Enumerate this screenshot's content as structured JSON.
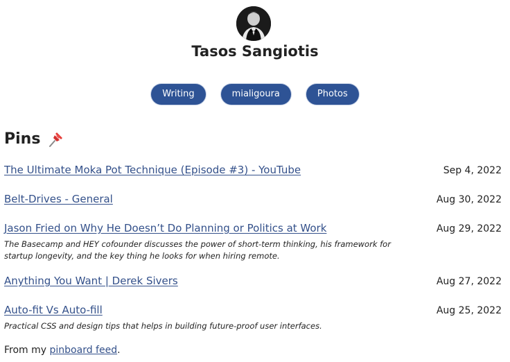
{
  "profile": {
    "name": "Tasos Sangiotis"
  },
  "nav": [
    {
      "label": "Writing"
    },
    {
      "label": "mialigoura"
    },
    {
      "label": "Photos"
    }
  ],
  "pins": {
    "title": "Pins",
    "icon": "pushpin-icon",
    "items": [
      {
        "title": "The Ultimate Moka Pot Technique (Episode #3) - YouTube",
        "date": "Sep 4, 2022",
        "description": ""
      },
      {
        "title": "Belt-Drives - General",
        "date": "Aug 30, 2022",
        "description": ""
      },
      {
        "title": "Jason Fried on Why He Doesn’t Do Planning or Politics at Work",
        "date": "Aug 29, 2022",
        "description": "The Basecamp and HEY cofounder discusses the power of short-term thinking, his framework for startup longevity, and the key thing he looks for when hiring remote."
      },
      {
        "title": "Anything You Want | Derek Sivers",
        "date": "Aug 27, 2022",
        "description": ""
      },
      {
        "title": "Auto-fit Vs Auto-fill",
        "date": "Aug 25, 2022",
        "description": "Practical CSS and design tips that helps in building future-proof user interfaces."
      }
    ]
  },
  "footer": {
    "prefix": "From my ",
    "link": "pinboard feed",
    "suffix": "."
  },
  "colors": {
    "accent": "#2e5395",
    "link": "#33508a",
    "text": "#222222"
  }
}
